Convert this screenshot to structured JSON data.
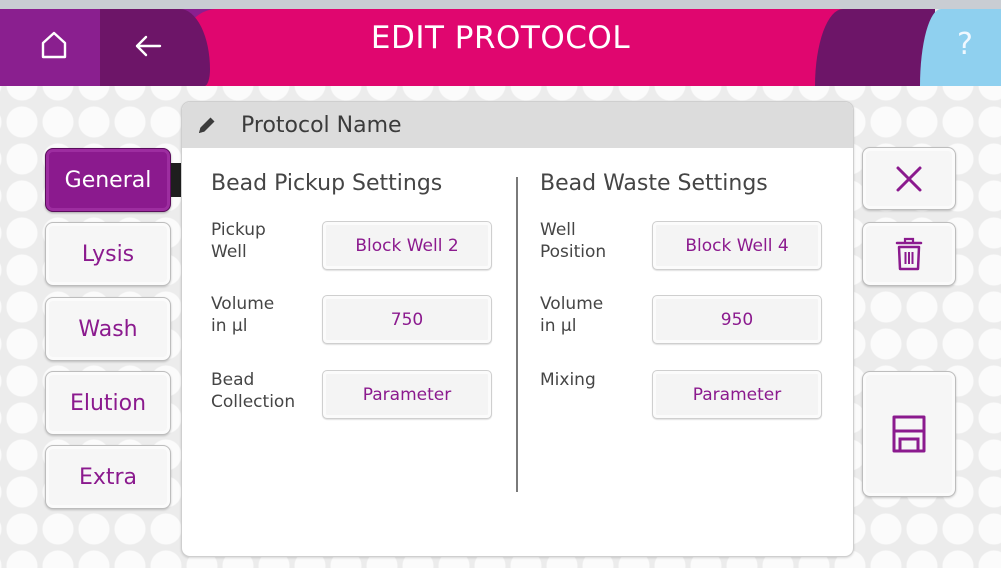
{
  "header": {
    "title": "EDIT PROTOCOL",
    "help_label": "?",
    "back_label": "←"
  },
  "panel": {
    "title": "Protocol Name"
  },
  "tabs": [
    {
      "label": "General",
      "active": true
    },
    {
      "label": "Lysis",
      "active": false
    },
    {
      "label": "Wash",
      "active": false
    },
    {
      "label": "Elution",
      "active": false
    },
    {
      "label": "Extra",
      "active": false
    }
  ],
  "bead_pickup": {
    "title": "Bead Pickup Settings",
    "fields": [
      {
        "label_line1": "Pickup",
        "label_line2": "Well",
        "value": "Block Well 2"
      },
      {
        "label_line1": "Volume",
        "label_line2": "in µl",
        "value": "750"
      },
      {
        "label_line1": "Bead",
        "label_line2": "Collection",
        "value": "Parameter"
      }
    ]
  },
  "bead_waste": {
    "title": "Bead Waste Settings",
    "fields": [
      {
        "label_line1": "Well",
        "label_line2": "Position",
        "value": "Block Well 4"
      },
      {
        "label_line1": "Volume",
        "label_line2": "in µl",
        "value": "950"
      },
      {
        "label_line1": "Mixing",
        "label_line2": "",
        "value": "Parameter"
      }
    ]
  },
  "actions": {
    "cancel_icon": "close-icon",
    "delete_icon": "trash-icon",
    "save_icon": "save-icon"
  },
  "colors": {
    "accent": "#8b1a8e",
    "header_pink": "#e0066f",
    "header_purple": "#6d1568",
    "header_light_blue": "#8fd0ef"
  }
}
